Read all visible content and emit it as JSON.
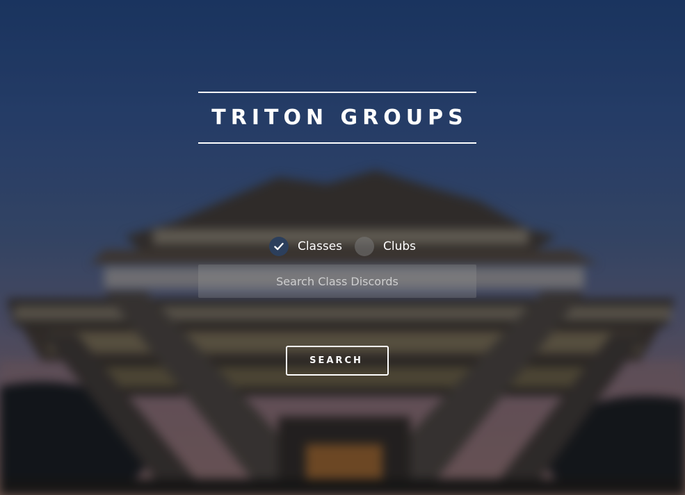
{
  "header": {
    "title": "TRITON GROUPS"
  },
  "search_type": {
    "options": [
      {
        "label": "Classes",
        "checked": true
      },
      {
        "label": "Clubs",
        "checked": false
      }
    ]
  },
  "search": {
    "placeholder": "Search Class Discords",
    "value": "",
    "button_label": "SEARCH"
  },
  "icons": {
    "selected_option": "checkmark-icon"
  },
  "colors": {
    "sky_top": "#1f3f72",
    "horizon": "#8a6a5e",
    "radio_checked": "#2c3f5c",
    "text": "#ffffff"
  }
}
